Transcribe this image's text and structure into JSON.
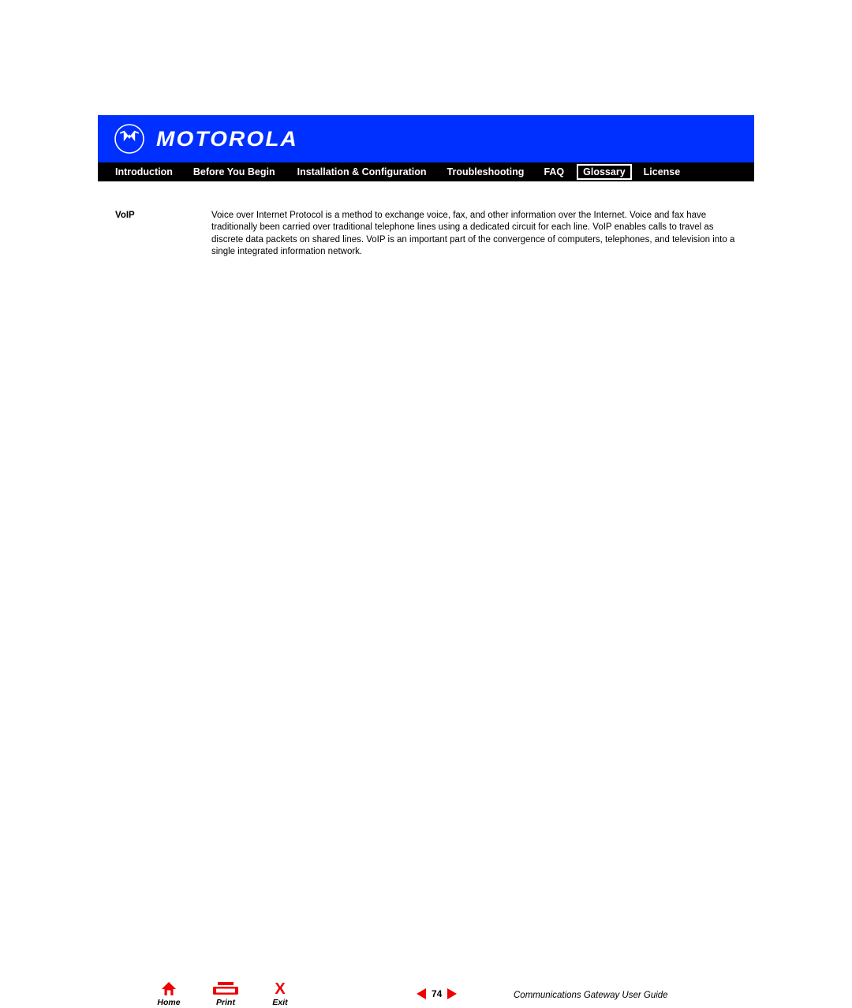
{
  "banner": {
    "brand": "MOTOROLA",
    "logo_icon": "motorola-batwing-logo-icon",
    "bg_color": "#0030ff"
  },
  "nav": {
    "bg_color": "#000000",
    "active_tab": "Glossary",
    "items": [
      {
        "label": "Introduction",
        "active": false
      },
      {
        "label": "Before You Begin",
        "active": false
      },
      {
        "label": "Installation & Configuration",
        "active": false
      },
      {
        "label": "Troubleshooting",
        "active": false
      },
      {
        "label": "FAQ",
        "active": false
      },
      {
        "label": "Glossary",
        "active": true
      },
      {
        "label": "License",
        "active": false
      }
    ]
  },
  "content": {
    "entries": [
      {
        "term": "VoIP",
        "definition": "Voice over Internet Protocol is a method to exchange voice, fax, and other information over the Internet. Voice and fax have traditionally been carried over traditional telephone lines using a dedicated circuit for each line. VoIP enables calls to travel as discrete data packets on shared lines. VoIP is an important part of the convergence of computers, telephones, and television into a single integrated information network."
      }
    ]
  },
  "footer": {
    "accent_color": "#ee0000",
    "buttons": [
      {
        "label": "Home",
        "icon": "home-icon"
      },
      {
        "label": "Print",
        "icon": "printer-icon"
      },
      {
        "label": "Exit",
        "icon": "close-x-icon"
      }
    ],
    "pager": {
      "prev_icon": "triangle-left-icon",
      "next_icon": "triangle-right-icon",
      "page_number": "74"
    },
    "guide_title": "Communications Gateway User Guide"
  }
}
